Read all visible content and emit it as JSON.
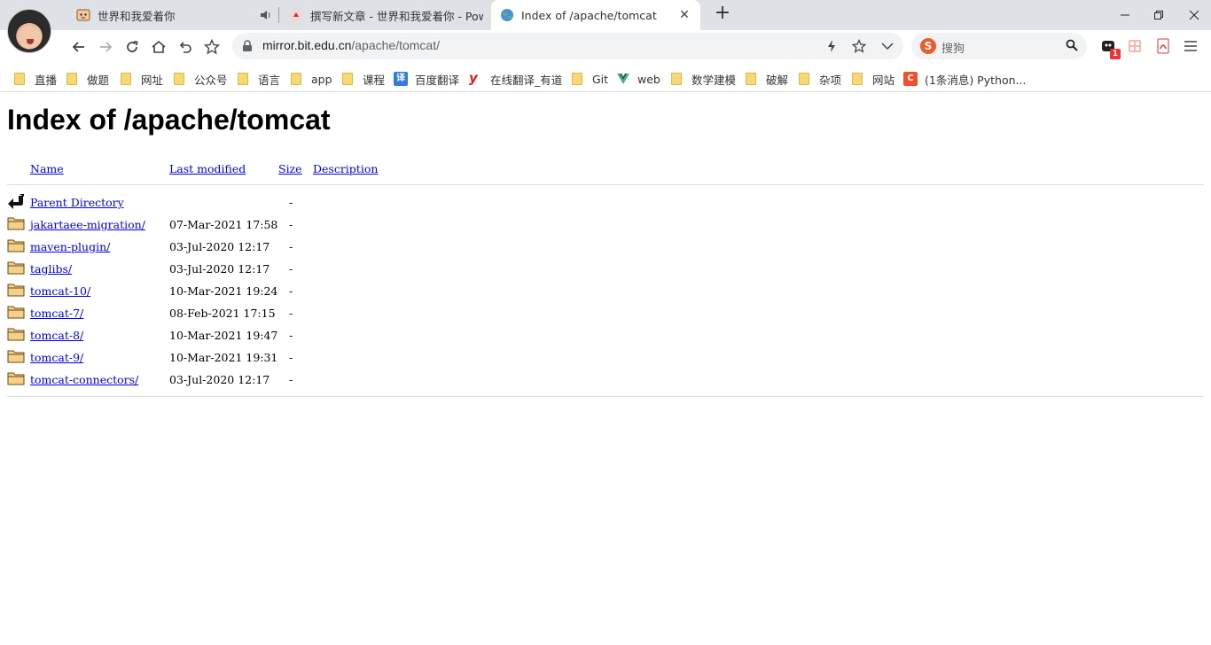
{
  "browser": {
    "tabs": [
      {
        "title": "世界和我爱着你",
        "active": false,
        "audio": true
      },
      {
        "title": "撰写新文章 - 世界和我爱着你 - Pow",
        "active": false
      },
      {
        "title": "Index of /apache/tomcat",
        "active": true
      }
    ],
    "newtab_label": "+",
    "address": {
      "host": "mirror.bit.edu.cn",
      "path": "/apache/tomcat/"
    },
    "search": {
      "placeholder": "搜狗",
      "logo": "S"
    },
    "extension_badge": "1"
  },
  "bookmarks": [
    {
      "label": "直播",
      "icon": "folder"
    },
    {
      "label": "做题",
      "icon": "folder"
    },
    {
      "label": "网址",
      "icon": "folder"
    },
    {
      "label": "公众号",
      "icon": "folder"
    },
    {
      "label": "语言",
      "icon": "folder"
    },
    {
      "label": "app",
      "icon": "folder"
    },
    {
      "label": "课程",
      "icon": "folder"
    },
    {
      "label": "百度翻译",
      "icon": "baidu-translate",
      "glyph": "译",
      "color": "#2f7de1"
    },
    {
      "label": "在线翻译_有道",
      "icon": "youdao",
      "glyph": "y",
      "color": "#e02020"
    },
    {
      "label": "Git",
      "icon": "folder"
    },
    {
      "label": "web",
      "icon": "vue"
    },
    {
      "label": "数学建模",
      "icon": "folder"
    },
    {
      "label": "破解",
      "icon": "folder"
    },
    {
      "label": "杂项",
      "icon": "folder"
    },
    {
      "label": "网站",
      "icon": "folder"
    },
    {
      "label": "(1条消息) Python...",
      "icon": "csdn",
      "glyph": "C",
      "color": "#f0502b"
    }
  ],
  "page": {
    "title": "Index of /apache/tomcat",
    "headers": {
      "name": "Name",
      "modified": "Last modified",
      "size": "Size",
      "description": "Description"
    },
    "entries": [
      {
        "name": "Parent Directory",
        "modified": "",
        "size": "-",
        "icon": "back"
      },
      {
        "name": "jakartaee-migration/",
        "modified": "07-Mar-2021 17:58",
        "size": "-",
        "icon": "folder"
      },
      {
        "name": "maven-plugin/",
        "modified": "03-Jul-2020 12:17",
        "size": "-",
        "icon": "folder"
      },
      {
        "name": "taglibs/",
        "modified": "03-Jul-2020 12:17",
        "size": "-",
        "icon": "folder"
      },
      {
        "name": "tomcat-10/",
        "modified": "10-Mar-2021 19:24",
        "size": "-",
        "icon": "folder"
      },
      {
        "name": "tomcat-7/",
        "modified": "08-Feb-2021 17:15",
        "size": "-",
        "icon": "folder"
      },
      {
        "name": "tomcat-8/",
        "modified": "10-Mar-2021 19:47",
        "size": "-",
        "icon": "folder"
      },
      {
        "name": "tomcat-9/",
        "modified": "10-Mar-2021 19:31",
        "size": "-",
        "icon": "folder"
      },
      {
        "name": "tomcat-connectors/",
        "modified": "03-Jul-2020 12:17",
        "size": "-",
        "icon": "folder"
      }
    ]
  }
}
